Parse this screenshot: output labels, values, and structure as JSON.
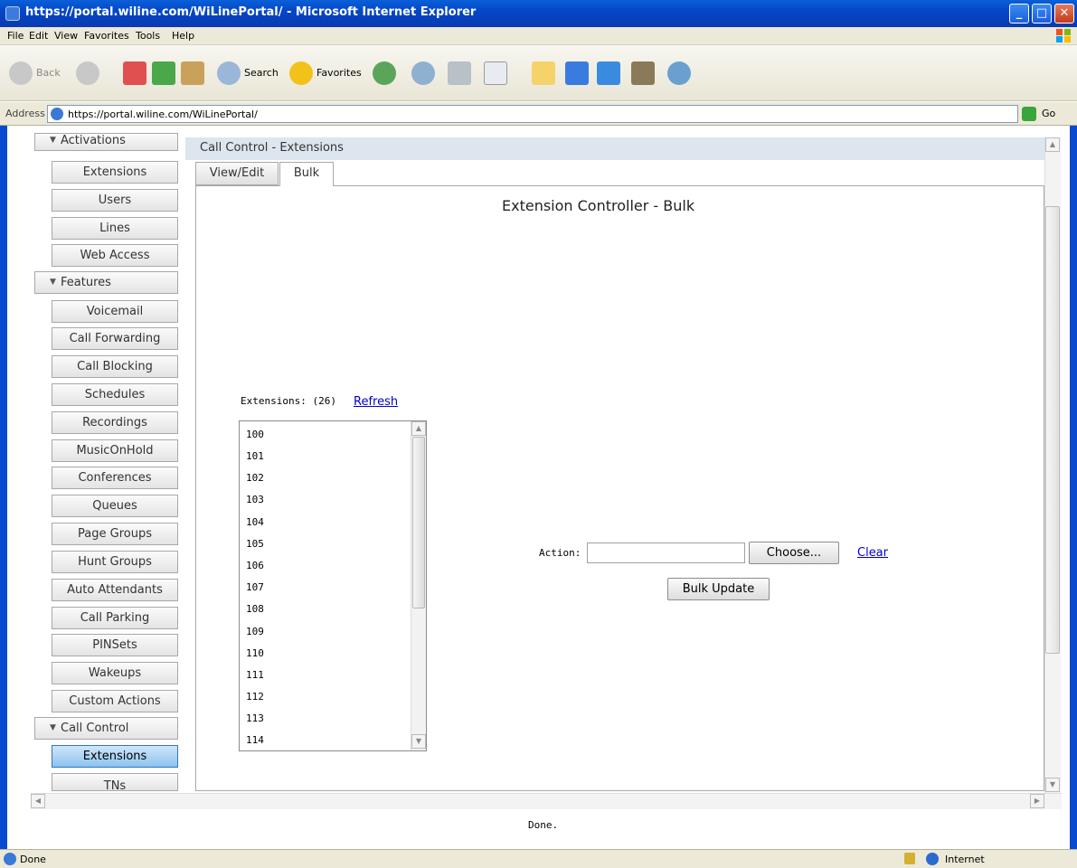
{
  "window": {
    "title": "https://portal.wiline.com/WiLinePortal/ - Microsoft Internet Explorer",
    "minimize_icon": "minimize-icon",
    "maximize_icon": "maximize-icon",
    "close_icon": "close-icon"
  },
  "menubar": {
    "items": [
      "File",
      "Edit",
      "View",
      "Favorites",
      "Tools",
      "Help"
    ]
  },
  "toolbar": {
    "back_label": "Back",
    "search_label": "Search",
    "favorites_label": "Favorites"
  },
  "address": {
    "label": "Address",
    "url": "https://portal.wiline.com/WiLinePortal/",
    "go_label": "Go"
  },
  "sidebar": {
    "activations": "Activations",
    "activation_items": [
      "Extensions",
      "Users",
      "Lines",
      "Web Access"
    ],
    "features": "Features",
    "feature_items": [
      "Voicemail",
      "Call Forwarding",
      "Call Blocking",
      "Schedules",
      "Recordings",
      "MusicOnHold",
      "Conferences",
      "Queues",
      "Page Groups",
      "Hunt Groups",
      "Auto Attendants",
      "Call Parking",
      "PINSets",
      "Wakeups",
      "Custom Actions"
    ],
    "call_control": "Call Control",
    "call_control_items": [
      "Extensions",
      "TNs"
    ],
    "selected": "Extensions"
  },
  "main": {
    "panel_title": "Call Control - Extensions",
    "tabs": [
      "View/Edit",
      "Bulk"
    ],
    "active_tab": "Bulk",
    "controller_title": "Extension Controller - Bulk",
    "extensions_label": "Extensions: (26)",
    "refresh_label": "Refresh",
    "extensions": [
      "100",
      "101",
      "102",
      "103",
      "104",
      "105",
      "106",
      "107",
      "108",
      "109",
      "110",
      "111",
      "112",
      "113",
      "114"
    ],
    "action_label": "Action:",
    "action_value": "",
    "choose_label": "Choose...",
    "clear_label": "Clear",
    "bulk_update_label": "Bulk Update",
    "done_message": "Done."
  },
  "statusbar": {
    "status": "Done",
    "zone": "Internet"
  },
  "colors": {
    "titlebar": "#0346c8",
    "selected_sidebar": "#8cc3ef",
    "link": "#0000cc"
  }
}
